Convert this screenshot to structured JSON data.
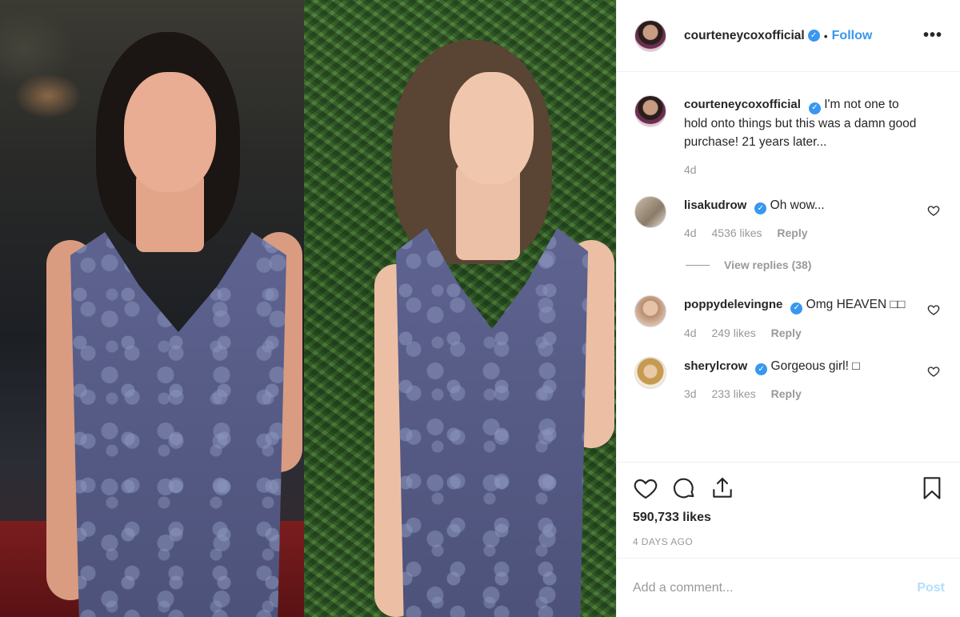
{
  "header": {
    "username": "courteneycoxofficial",
    "separator": "•",
    "follow_label": "Follow",
    "more_label": "•••",
    "verified_mark": "✓"
  },
  "caption": {
    "username": "courteneycoxofficial",
    "text": "I'm not one to hold onto things but this was a damn good purchase! 21 years later...",
    "age": "4d"
  },
  "comments": [
    {
      "username": "lisakudrow",
      "text": "Oh wow...",
      "age": "4d",
      "likes": "4536 likes",
      "reply": "Reply",
      "view_replies": "View replies (38)"
    },
    {
      "username": "poppydelevingne",
      "text": "Omg HEAVEN □□",
      "age": "4d",
      "likes": "249 likes",
      "reply": "Reply"
    },
    {
      "username": "sherylcrow",
      "text": "Gorgeous girl! □",
      "age": "3d",
      "likes": "233 likes",
      "reply": "Reply"
    }
  ],
  "actions": {
    "icons": [
      "heart-icon",
      "comment-icon",
      "share-icon",
      "bookmark-icon"
    ],
    "likes": "590,733 likes",
    "posted": "4 DAYS AGO"
  },
  "add_comment": {
    "placeholder": "Add a comment...",
    "post_label": "Post"
  },
  "colors": {
    "accent": "#3897f0",
    "post_disabled": "#b2dffc",
    "muted": "#999999",
    "text": "#262626"
  }
}
